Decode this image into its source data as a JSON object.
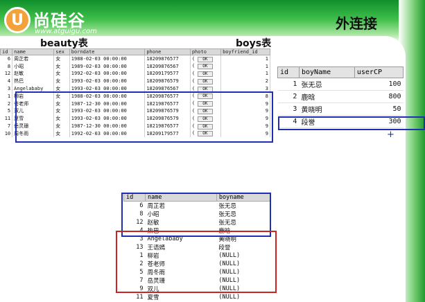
{
  "slide": {
    "title": "外连接",
    "logo": {
      "name": "尚硅谷",
      "url": "www.atguigu.com",
      "mark": "U"
    },
    "beauty_label": "beauty表",
    "boys_label": "boys表",
    "plus_mark": "+"
  },
  "beauty_table": {
    "columns": [
      "id",
      "name",
      "sex",
      "borndate",
      "phone",
      "photo",
      "boyfriend_id"
    ],
    "button_label": "OK",
    "rows": [
      [
        "6",
        "周芷若",
        "女",
        "1988-02-03 00:00:00",
        "18209876577",
        "(",
        "1"
      ],
      [
        "8",
        "小昭",
        "女",
        "1989-02-03 00:00:00",
        "18209876567",
        "(",
        "1"
      ],
      [
        "12",
        "赵敏",
        "女",
        "1992-02-03 00:00:00",
        "18209179577",
        "(",
        "1"
      ],
      [
        "4",
        "热巴",
        "女",
        "1993-02-03 00:00:00",
        "18209876579",
        "(",
        "2"
      ],
      [
        "3",
        "Angelababy",
        "女",
        "1993-02-03 00:00:00",
        "18209876567",
        "(",
        "3"
      ],
      [
        "1",
        "柳岩",
        "女",
        "1988-02-03 00:00:00",
        "18209876577",
        "(",
        "8"
      ],
      [
        "2",
        "苍老师",
        "女",
        "1987-12-30 00:00:00",
        "18219876577",
        "(",
        "9"
      ],
      [
        "5",
        "双儿",
        "女",
        "1993-02-03 00:00:00",
        "18209876579",
        "(",
        "9"
      ],
      [
        "11",
        "夏雪",
        "女",
        "1993-02-03 00:00:00",
        "18209876579",
        "(",
        "9"
      ],
      [
        "7",
        "岳灵珊",
        "女",
        "1987-12-30 00:00:00",
        "18219876577",
        "(",
        "9"
      ],
      [
        "10",
        "周冬雨",
        "女",
        "1992-02-03 00:00:00",
        "18209179577",
        "(",
        "9"
      ]
    ]
  },
  "boys_table": {
    "columns": [
      "id",
      "boyName",
      "userCP"
    ],
    "rows": [
      [
        "1",
        "张无忌",
        "100"
      ],
      [
        "2",
        "鹿晗",
        "800"
      ],
      [
        "3",
        "黄晓明",
        "50"
      ],
      [
        "4",
        "段誉",
        "300"
      ]
    ]
  },
  "result_table": {
    "columns": [
      "id",
      "name",
      "boyname"
    ],
    "rows": [
      [
        "6",
        "周芷若",
        "张无忌"
      ],
      [
        "8",
        "小昭",
        "张无忌"
      ],
      [
        "12",
        "赵敏",
        "张无忌"
      ],
      [
        "4",
        "热巴",
        "鹿晗"
      ],
      [
        "3",
        "Angelababy",
        "黄晓明"
      ],
      [
        "13",
        "王语嫣",
        "段誉"
      ],
      [
        "1",
        "柳岩",
        "(NULL)"
      ],
      [
        "2",
        "苍老师",
        "(NULL)"
      ],
      [
        "5",
        "周冬雨",
        "(NULL)"
      ],
      [
        "7",
        "岳灵珊",
        "(NULL)"
      ],
      [
        "9",
        "双儿",
        "(NULL)"
      ],
      [
        "11",
        "夏雪",
        "(NULL)"
      ]
    ]
  },
  "colors": {
    "highlight_blue": "#1f2fb3",
    "highlight_red": "#cc2222",
    "brand_green": "#1e9a2e",
    "logo_orange": "#f3a23b"
  }
}
